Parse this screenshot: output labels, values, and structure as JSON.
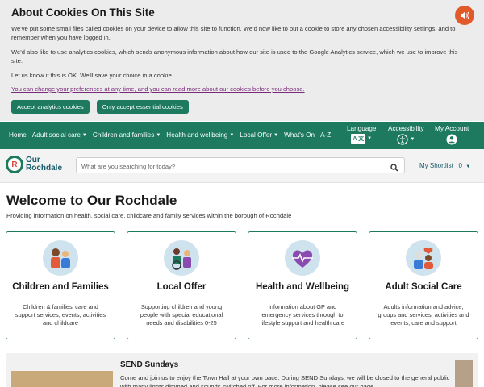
{
  "cookie": {
    "title": "About Cookies On This Site",
    "p1": "We've put some small files called cookies on your device to allow this site to function. We'd now like to put a cookie to store any chosen accessibility settings, and to remember when you have logged in.",
    "p2": "We'd also like to use analytics cookies, which sends anonymous information about how our site is used to the Google Analytics service, which we use to improve this site.",
    "p3": "Let us know if this is OK. We'll save your choice in a cookie.",
    "link": "You can change your preferences at any time, and you can read more about our cookies before you choose.",
    "accept_analytics": "Accept analytics cookies",
    "accept_essential": "Only accept essential cookies"
  },
  "nav": {
    "items": [
      "Home",
      "Adult social care",
      "Children and families",
      "Health and wellbeing",
      "Local Offer",
      "What's On",
      "A-Z"
    ],
    "language": "Language",
    "accessibility": "Accessibility",
    "account": "My Account"
  },
  "header": {
    "logo_line1": "Our",
    "logo_line2": "Rochdale",
    "search_placeholder": "What are you searching for today?",
    "shortlist": "My Shortlist",
    "shortlist_count": "0"
  },
  "main": {
    "title": "Welcome to Our Rochdale",
    "subtitle": "Providing information on health, social care, childcare and family services within the borough of Rochdale",
    "cards": [
      {
        "title": "Children and Families",
        "text": "Children & families' care and support services, events, activities and childcare"
      },
      {
        "title": "Local Offer",
        "text": "Supporting children and young people with special educational needs and disabilities 0-25"
      },
      {
        "title": "Health and Wellbeing",
        "text": "Information about GP and emergency services through to lifestyle support and health care"
      },
      {
        "title": "Adult Social Care",
        "text": "Adults information and advice, groups and services, activities and events, care and support"
      }
    ]
  },
  "send": {
    "title": "SEND Sundays",
    "text": "Come and join us to enjoy the Town Hall at your own pace. During SEND Sundays, we will be closed to the general public with many lights dimmed and sounds switched off. For more information, please see our page."
  },
  "colors": {
    "brand": "#1d7a5f",
    "speaker": "#e05a2a"
  }
}
